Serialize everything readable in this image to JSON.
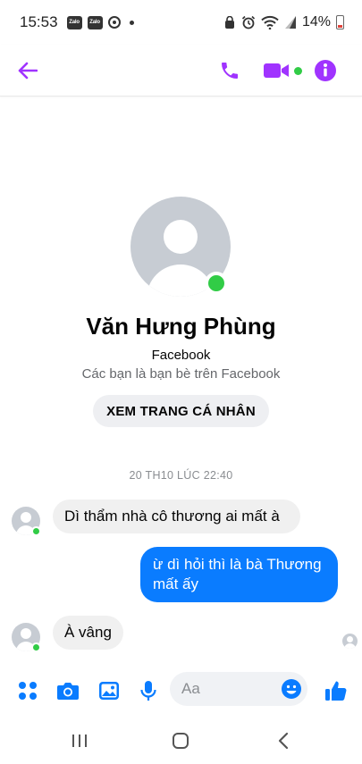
{
  "status_bar": {
    "time": "15:53",
    "app_icons": [
      "Zalo",
      "Zalo"
    ],
    "battery": "14%"
  },
  "header": {
    "icons": [
      "back-arrow-icon",
      "phone-icon",
      "video-camera-icon",
      "info-icon"
    ],
    "accent_color": "#a033ff",
    "online_color": "#31cc46"
  },
  "profile": {
    "name": "Văn Hưng Phùng",
    "source": "Facebook",
    "friends_note": "Các bạn là bạn bè trên Facebook",
    "view_profile_label": "XEM TRANG CÁ NHÂN"
  },
  "conversation": {
    "timestamp": "20 TH10 LÚC 22:40",
    "messages": [
      {
        "from": "them",
        "text": "Dì thẩm nhà cô thương ai mất à"
      },
      {
        "from": "me",
        "text": "ừ dì hỏi thì là bà Thương mất ấy"
      },
      {
        "from": "them",
        "text": "À vâng"
      }
    ],
    "outgoing_color": "#0a7cff",
    "incoming_color": "#f0f0f0"
  },
  "composer": {
    "placeholder": "Aa",
    "icons": [
      "apps-grid-icon",
      "camera-icon",
      "gallery-icon",
      "microphone-icon",
      "emoji-icon",
      "like-thumb-icon"
    ],
    "icon_color": "#0a7cff"
  },
  "navbar": {
    "icons": [
      "recent-apps-icon",
      "home-icon",
      "back-icon"
    ]
  }
}
